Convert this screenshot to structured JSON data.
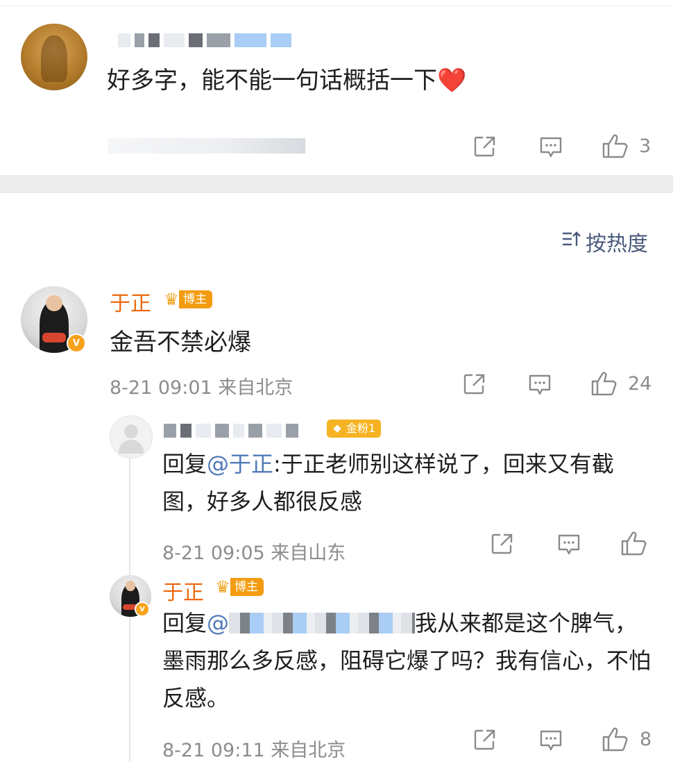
{
  "comment1": {
    "text": "好多字，能不能一句话概括一下",
    "emoji": "❤️",
    "like_count": "3"
  },
  "sort": {
    "label": "按热度",
    "icon": "sort-icon"
  },
  "comment2": {
    "author": "于正",
    "badge": "博主",
    "text": "金吾不禁必爆",
    "time": "8-21 09:01",
    "location": "来自北京",
    "like_count": "24"
  },
  "reply1": {
    "badge": "金粉1",
    "prefix": "回复",
    "mention": "@于正",
    "text": ":于正老师别这样说了，回来又有截图，好多人都很反感",
    "time": "8-21 09:05",
    "location": "来自山东"
  },
  "reply2": {
    "author": "于正",
    "badge": "博主",
    "prefix": "回复",
    "mention": "@",
    "text": "我从来都是这个脾气，墨雨那么多反感，阻碍它爆了吗？我有信心，不怕反感。",
    "time": "8-21 09:11",
    "location": "来自北京",
    "like_count": "8"
  },
  "icons": {
    "share": "share-icon",
    "comment": "comment-icon",
    "like": "thumbs-up-icon",
    "verified": "verified-v-icon",
    "crown": "crown-icon"
  },
  "colors": {
    "name": "#ec6a10",
    "mention": "#5079b8",
    "badge_host": "#f39c12",
    "badge_fan": "#f5b323",
    "meta": "#8c8c8c"
  }
}
